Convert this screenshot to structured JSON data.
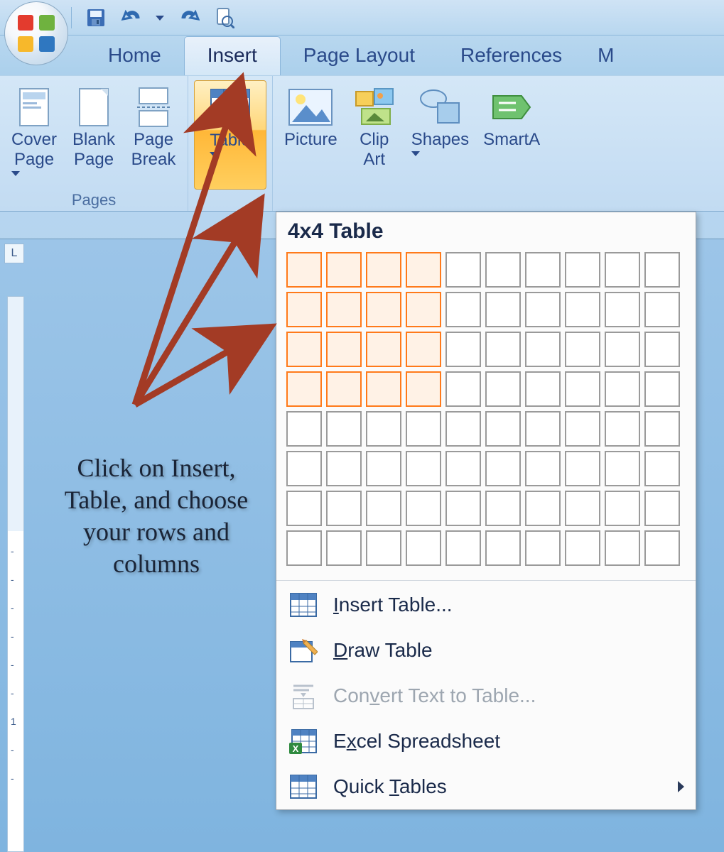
{
  "qat": {
    "save": "save-icon",
    "undo": "undo-icon",
    "redo": "redo-icon",
    "preview": "print-preview-icon"
  },
  "tabs": {
    "home": "Home",
    "insert": "Insert",
    "page_layout": "Page Layout",
    "references": "References",
    "next_partial": "M"
  },
  "ribbon": {
    "pages_group_label": "Pages",
    "cover_page": "Cover\nPage",
    "blank_page": "Blank\nPage",
    "page_break": "Page\nBreak",
    "table": "Table",
    "picture": "Picture",
    "clip_art": "Clip\nArt",
    "shapes": "Shapes",
    "smartart": "SmartA"
  },
  "dropdown": {
    "header": "4x4 Table",
    "grid_cols": 10,
    "grid_rows": 8,
    "selected_cols": 4,
    "selected_rows": 4,
    "items": {
      "insert_table": "Insert Table...",
      "draw_table": "Draw Table",
      "convert_text": "Convert Text to Table...",
      "excel": "Excel Spreadsheet",
      "quick_tables": "Quick Tables"
    }
  },
  "annotation": "Click on Insert, Table, and choose your rows and columns",
  "ruler_corner": "L",
  "ruler_ticks": [
    "-",
    "-",
    "-",
    "-",
    "-",
    "-",
    "1",
    "-",
    "-",
    "-"
  ],
  "colors": {
    "arrow": "#a33b25",
    "highlight": "#ffb738",
    "sel_border": "#ff7a1a"
  }
}
